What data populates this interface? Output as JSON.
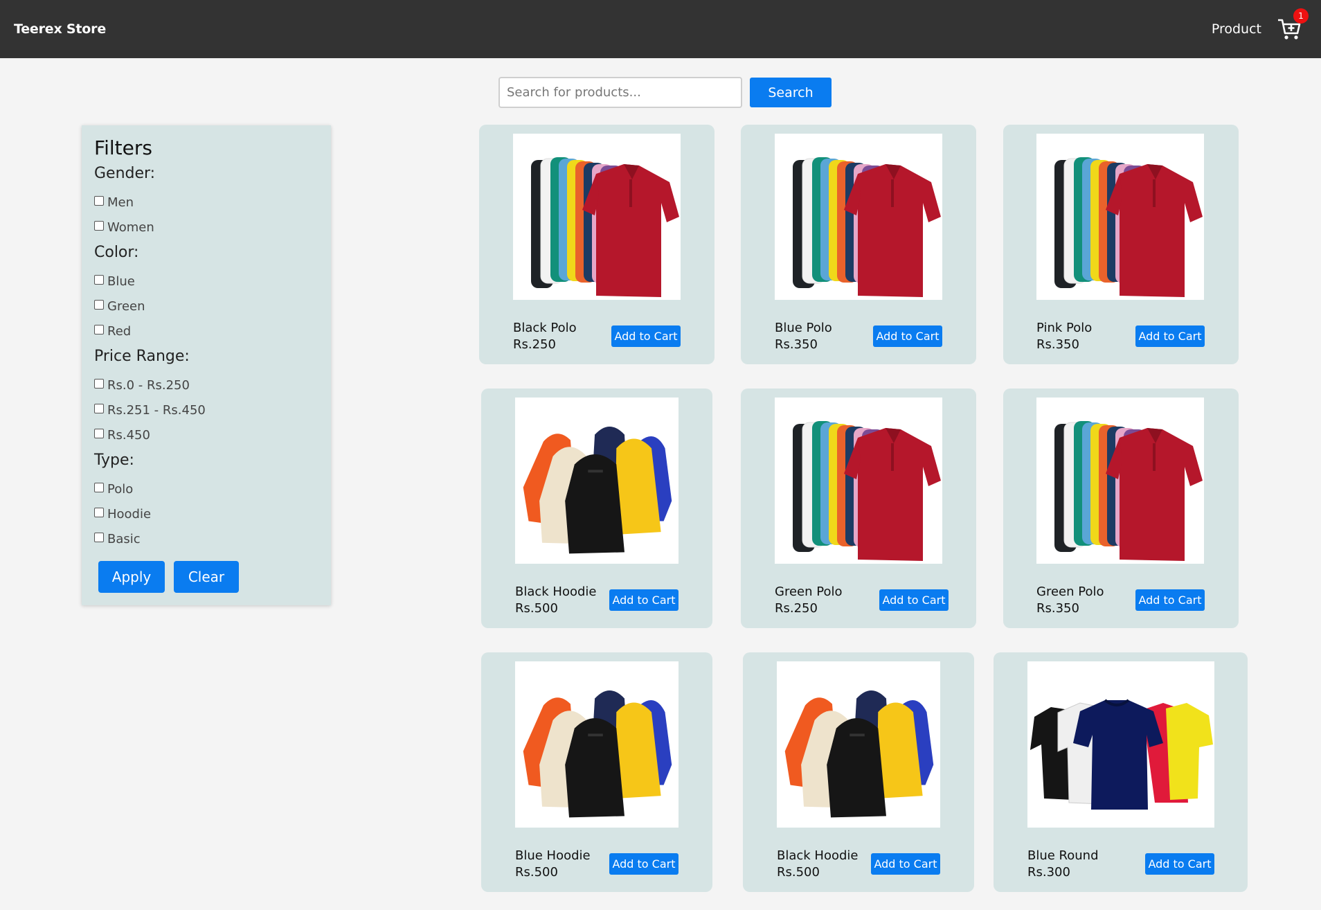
{
  "nav": {
    "brand": "Teerex Store",
    "product_link": "Product",
    "cart_count": "1"
  },
  "search": {
    "placeholder": "Search for products...",
    "button_label": "Search"
  },
  "filters": {
    "title": "Filters",
    "gender": {
      "title": "Gender:",
      "options": [
        "Men",
        "Women"
      ]
    },
    "color": {
      "title": "Color:",
      "options": [
        "Blue",
        "Green",
        "Red"
      ]
    },
    "price": {
      "title": "Price Range:",
      "options": [
        "Rs.0 - Rs.250",
        "Rs.251 - Rs.450",
        "Rs.450"
      ]
    },
    "type": {
      "title": "Type:",
      "options": [
        "Polo",
        "Hoodie",
        "Basic"
      ]
    },
    "apply_label": "Apply",
    "clear_label": "Clear"
  },
  "products": [
    {
      "name": "Black Polo",
      "price": "Rs.250",
      "image": "polo-shirts-image",
      "button": "Add to Cart"
    },
    {
      "name": "Blue Polo",
      "price": "Rs.350",
      "image": "polo-shirts-image",
      "button": "Add to Cart"
    },
    {
      "name": "Pink Polo",
      "price": "Rs.350",
      "image": "polo-shirts-image",
      "button": "Add to Cart"
    },
    {
      "name": "Black Hoodie",
      "price": "Rs.500",
      "image": "hoodies-image",
      "button": "Add to Cart"
    },
    {
      "name": "Green Polo",
      "price": "Rs.250",
      "image": "polo-shirts-image",
      "button": "Add to Cart"
    },
    {
      "name": "Green Polo",
      "price": "Rs.350",
      "image": "polo-shirts-image",
      "button": "Add to Cart"
    },
    {
      "name": "Blue Hoodie",
      "price": "Rs.500",
      "image": "hoodies-image",
      "button": "Add to Cart"
    },
    {
      "name": "Black Hoodie",
      "price": "Rs.500",
      "image": "hoodies-image",
      "button": "Add to Cart"
    },
    {
      "name": "Blue Round",
      "price": "Rs.300",
      "image": "round-tshirts-image",
      "button": "Add to Cart"
    }
  ],
  "colors": {
    "navbar": "#333333",
    "accent": "#0a7cf0",
    "card_bg": "#d6e4e4",
    "badge": "#ee1111"
  }
}
